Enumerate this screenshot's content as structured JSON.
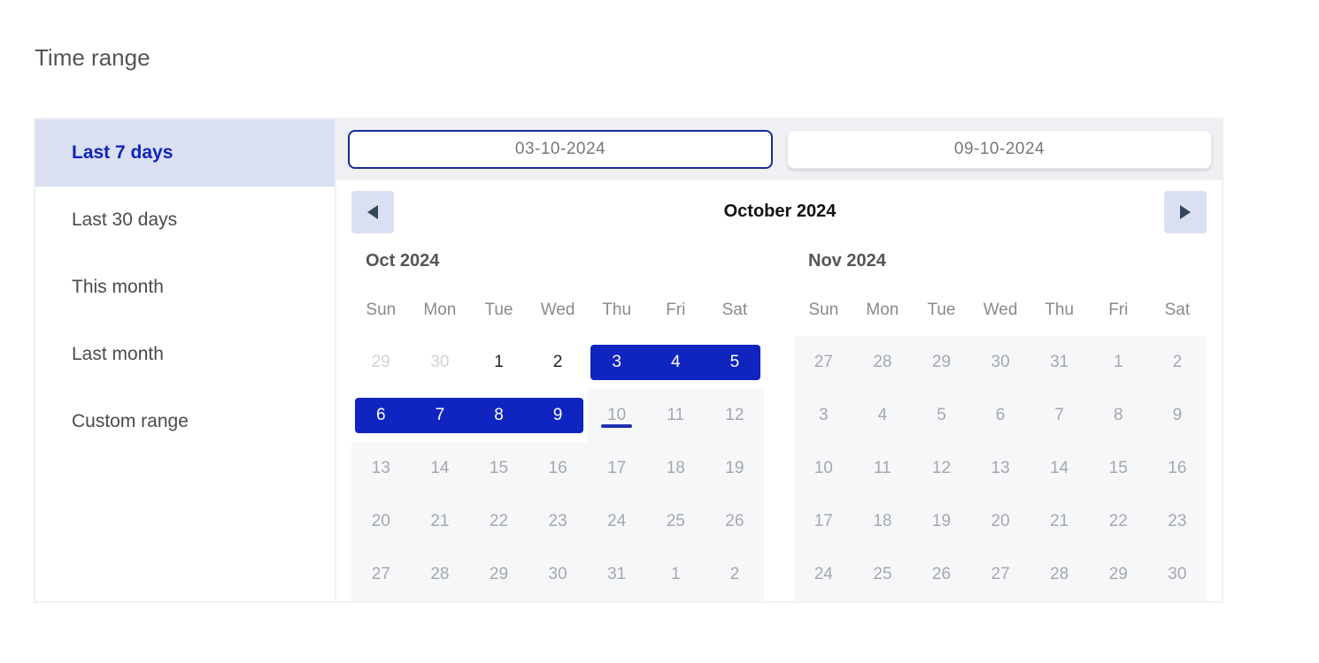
{
  "page": {
    "title": "Time range"
  },
  "colors": {
    "accent": "#1024C0",
    "active_bg": "#DADFF2",
    "disabled_bg": "#F6F7F8"
  },
  "sidebar": {
    "items": [
      {
        "label": "Last 7 days",
        "active": true
      },
      {
        "label": "Last 30 days",
        "active": false
      },
      {
        "label": "This month",
        "active": false
      },
      {
        "label": "Last month",
        "active": false
      },
      {
        "label": "Custom range",
        "active": false
      }
    ]
  },
  "inputs": {
    "start_date": "03-10-2024",
    "end_date": "09-10-2024"
  },
  "navigation": {
    "prev_icon": "caret-left-icon",
    "next_icon": "caret-right-icon",
    "current_month": "October 2024"
  },
  "calendars": [
    {
      "title": "Oct 2024",
      "weekdays": [
        "Sun",
        "Mon",
        "Tue",
        "Wed",
        "Thu",
        "Fri",
        "Sat"
      ],
      "weeks": [
        [
          {
            "d": "29",
            "s": "other"
          },
          {
            "d": "30",
            "s": "other"
          },
          {
            "d": "1",
            "s": "normal"
          },
          {
            "d": "2",
            "s": "normal"
          },
          {
            "d": "3",
            "s": "selected"
          },
          {
            "d": "4",
            "s": "selected"
          },
          {
            "d": "5",
            "s": "selected"
          }
        ],
        [
          {
            "d": "6",
            "s": "selected"
          },
          {
            "d": "7",
            "s": "selected"
          },
          {
            "d": "8",
            "s": "selected"
          },
          {
            "d": "9",
            "s": "selected"
          },
          {
            "d": "10",
            "s": "today"
          },
          {
            "d": "11",
            "s": "disabled"
          },
          {
            "d": "12",
            "s": "disabled"
          }
        ],
        [
          {
            "d": "13",
            "s": "disabled"
          },
          {
            "d": "14",
            "s": "disabled"
          },
          {
            "d": "15",
            "s": "disabled"
          },
          {
            "d": "16",
            "s": "disabled"
          },
          {
            "d": "17",
            "s": "disabled"
          },
          {
            "d": "18",
            "s": "disabled"
          },
          {
            "d": "19",
            "s": "disabled"
          }
        ],
        [
          {
            "d": "20",
            "s": "disabled"
          },
          {
            "d": "21",
            "s": "disabled"
          },
          {
            "d": "22",
            "s": "disabled"
          },
          {
            "d": "23",
            "s": "disabled"
          },
          {
            "d": "24",
            "s": "disabled"
          },
          {
            "d": "25",
            "s": "disabled"
          },
          {
            "d": "26",
            "s": "disabled"
          }
        ],
        [
          {
            "d": "27",
            "s": "disabled"
          },
          {
            "d": "28",
            "s": "disabled"
          },
          {
            "d": "29",
            "s": "disabled"
          },
          {
            "d": "30",
            "s": "disabled"
          },
          {
            "d": "31",
            "s": "disabled"
          },
          {
            "d": "1",
            "s": "disabled"
          },
          {
            "d": "2",
            "s": "disabled"
          }
        ]
      ]
    },
    {
      "title": "Nov 2024",
      "weekdays": [
        "Sun",
        "Mon",
        "Tue",
        "Wed",
        "Thu",
        "Fri",
        "Sat"
      ],
      "weeks": [
        [
          {
            "d": "27",
            "s": "disabled"
          },
          {
            "d": "28",
            "s": "disabled"
          },
          {
            "d": "29",
            "s": "disabled"
          },
          {
            "d": "30",
            "s": "disabled"
          },
          {
            "d": "31",
            "s": "disabled"
          },
          {
            "d": "1",
            "s": "disabled"
          },
          {
            "d": "2",
            "s": "disabled"
          }
        ],
        [
          {
            "d": "3",
            "s": "disabled"
          },
          {
            "d": "4",
            "s": "disabled"
          },
          {
            "d": "5",
            "s": "disabled"
          },
          {
            "d": "6",
            "s": "disabled"
          },
          {
            "d": "7",
            "s": "disabled"
          },
          {
            "d": "8",
            "s": "disabled"
          },
          {
            "d": "9",
            "s": "disabled"
          }
        ],
        [
          {
            "d": "10",
            "s": "disabled"
          },
          {
            "d": "11",
            "s": "disabled"
          },
          {
            "d": "12",
            "s": "disabled"
          },
          {
            "d": "13",
            "s": "disabled"
          },
          {
            "d": "14",
            "s": "disabled"
          },
          {
            "d": "15",
            "s": "disabled"
          },
          {
            "d": "16",
            "s": "disabled"
          }
        ],
        [
          {
            "d": "17",
            "s": "disabled"
          },
          {
            "d": "18",
            "s": "disabled"
          },
          {
            "d": "19",
            "s": "disabled"
          },
          {
            "d": "20",
            "s": "disabled"
          },
          {
            "d": "21",
            "s": "disabled"
          },
          {
            "d": "22",
            "s": "disabled"
          },
          {
            "d": "23",
            "s": "disabled"
          }
        ],
        [
          {
            "d": "24",
            "s": "disabled"
          },
          {
            "d": "25",
            "s": "disabled"
          },
          {
            "d": "26",
            "s": "disabled"
          },
          {
            "d": "27",
            "s": "disabled"
          },
          {
            "d": "28",
            "s": "disabled"
          },
          {
            "d": "29",
            "s": "disabled"
          },
          {
            "d": "30",
            "s": "disabled"
          }
        ]
      ]
    }
  ]
}
